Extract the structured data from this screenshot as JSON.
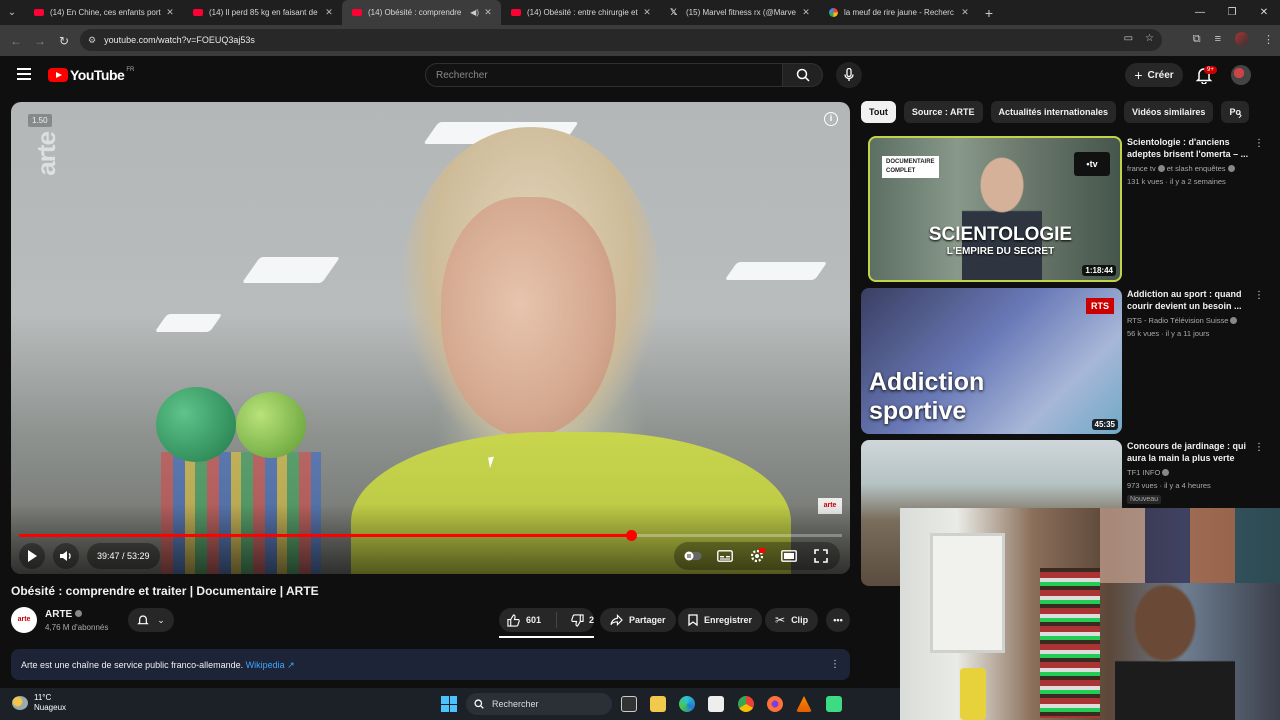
{
  "browser": {
    "tabs": [
      {
        "title": "(14) En Chine, ces enfants porte",
        "favicon": "youtube-icon"
      },
      {
        "title": "(14) Il perd 85 kg en faisant de",
        "favicon": "youtube-icon"
      },
      {
        "title": "(14) Obésité : comprendre",
        "favicon": "youtube-icon",
        "active": true
      },
      {
        "title": "(14) Obésité : entre chirurgie et",
        "favicon": "youtube-icon"
      },
      {
        "title": "(15) Marvel fitness rx (@Marve",
        "favicon": "x-icon"
      },
      {
        "title": "la meuf de rire jaune - Recherc",
        "favicon": "google-icon"
      }
    ],
    "url": "youtube.com/watch?v=FOEUQ3aj53s"
  },
  "header": {
    "logo": "YouTube",
    "region": "FR",
    "search_placeholder": "Rechercher",
    "create_label": "Créer",
    "notif_badge": "9+"
  },
  "player": {
    "speed_overlay": "1.50",
    "watermark": "arte",
    "corner_logo": "arte",
    "time": "39:47 / 53:29",
    "progress": 0.744
  },
  "video": {
    "title": "Obésité : comprendre et traiter | Documentaire | ARTE",
    "channel": "ARTE",
    "channel_avatar_text": "arte",
    "subscribers": "4,76 M d'abonnés",
    "likes": "601",
    "dislikes": "2",
    "share_label": "Partager",
    "save_label": "Enregistrer",
    "clip_label": "Clip",
    "description": "Arte est une chaîne de service public franco-allemande.",
    "description_link": "Wikipedia ↗"
  },
  "chips": [
    "Tout",
    "Source : ARTE",
    "Actualités internationales",
    "Vidéos similaires",
    "Po"
  ],
  "recommendations": [
    {
      "title": "Scientologie : d'anciens adeptes brisent l'omerta – ...",
      "channel": "france tv",
      "channel_extra": "et slash enquêtes",
      "meta": "131 k vues · il y a 2 semaines",
      "duration": "1:18:44",
      "thumb_tag_1": "DOCUMENTAIRE",
      "thumb_tag_2": "COMPLET",
      "thumb_big": "SCIENTOLOGIE",
      "thumb_small": "L'EMPIRE DU SECRET",
      "thumb_logo": "•tv"
    },
    {
      "title": "Addiction au sport : quand courir devient un besoin ...",
      "channel": "RTS - Radio Télévision Suisse",
      "meta": "56 k vues · il y a 11 jours",
      "duration": "45:35",
      "thumb_big_1": "Addiction",
      "thumb_big_2": "sportive",
      "thumb_logo": "RTS"
    },
    {
      "title": "Concours de jardinage : qui aura la main la plus verte ?...",
      "channel": "TF1 INFO",
      "meta": "973 vues · il y a 4 heures",
      "badge": "Nouveau"
    }
  ],
  "taskbar": {
    "temperature": "11°C",
    "weather": "Nuageux",
    "search_label": "Rechercher"
  }
}
